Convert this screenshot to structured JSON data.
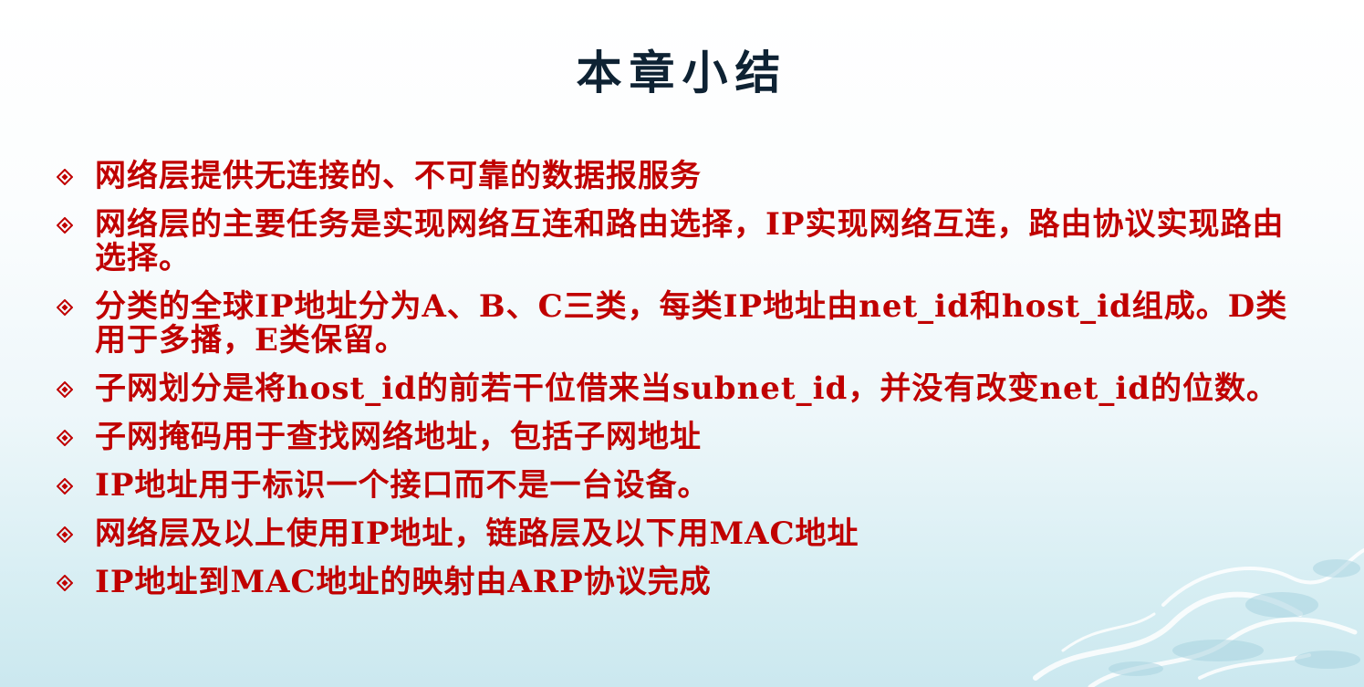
{
  "slide": {
    "title": "本章小结",
    "bullet_icon": "diamond-bullet-icon",
    "colors": {
      "title": "#0e2233",
      "bullet_text": "#c00000",
      "background_bottom": "#cbe8ef"
    },
    "bullets": [
      "网络层提供无连接的、不可靠的数据报服务",
      "网络层的主要任务是实现网络互连和路由选择，IP实现网络互连，路由协议实现路由选择。",
      "分类的全球IP地址分为A、B、C三类，每类IP地址由net_id和host_id组成。D类用于多播，E类保留。",
      "子网划分是将host_id的前若干位借来当subnet_id，并没有改变net_id的位数。",
      "子网掩码用于查找网络地址，包括子网地址",
      "IP地址用于标识一个接口而不是一台设备。",
      "网络层及以上使用IP地址，链路层及以下用MAC地址",
      "IP地址到MAC地址的映射由ARP协议完成"
    ]
  }
}
